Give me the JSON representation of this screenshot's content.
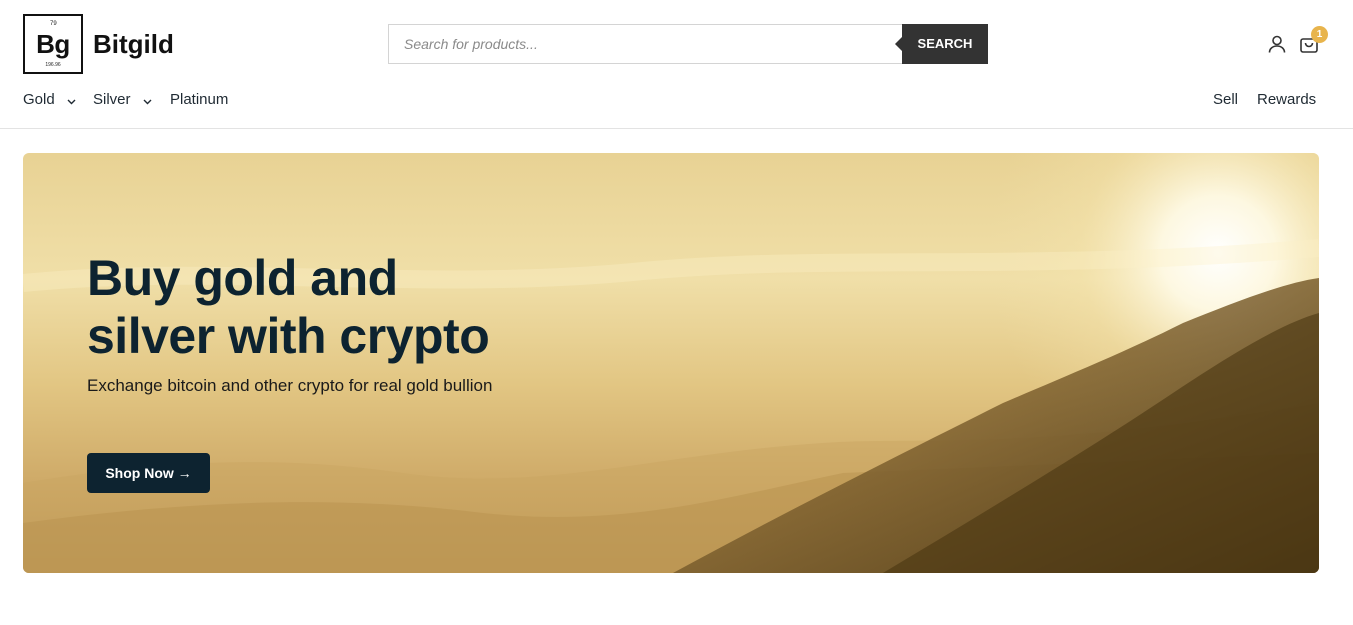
{
  "logo": {
    "atomic_number": "79",
    "symbol": "Bg",
    "atomic_mass": "196.96"
  },
  "brand": {
    "name": "Bitgild"
  },
  "search": {
    "placeholder": "Search for products...",
    "button_label": "SEARCH"
  },
  "header_icons": {
    "account_icon": "user-icon",
    "cart_icon": "shopping-bag-icon",
    "cart_count": "1",
    "badge_color": "#e8b44c"
  },
  "nav": {
    "left": [
      {
        "label": "Gold",
        "has_dropdown": true
      },
      {
        "label": "Silver",
        "has_dropdown": true
      },
      {
        "label": "Platinum",
        "has_dropdown": false
      }
    ],
    "right": [
      {
        "label": "Sell"
      },
      {
        "label": "Rewards"
      }
    ]
  },
  "hero": {
    "title_line1": "Buy gold and",
    "title_line2": "silver with crypto",
    "subtitle": "Exchange bitcoin and other crypto for real gold bullion",
    "cta_label": "Shop Now →",
    "accent_color": "#0d2330"
  }
}
